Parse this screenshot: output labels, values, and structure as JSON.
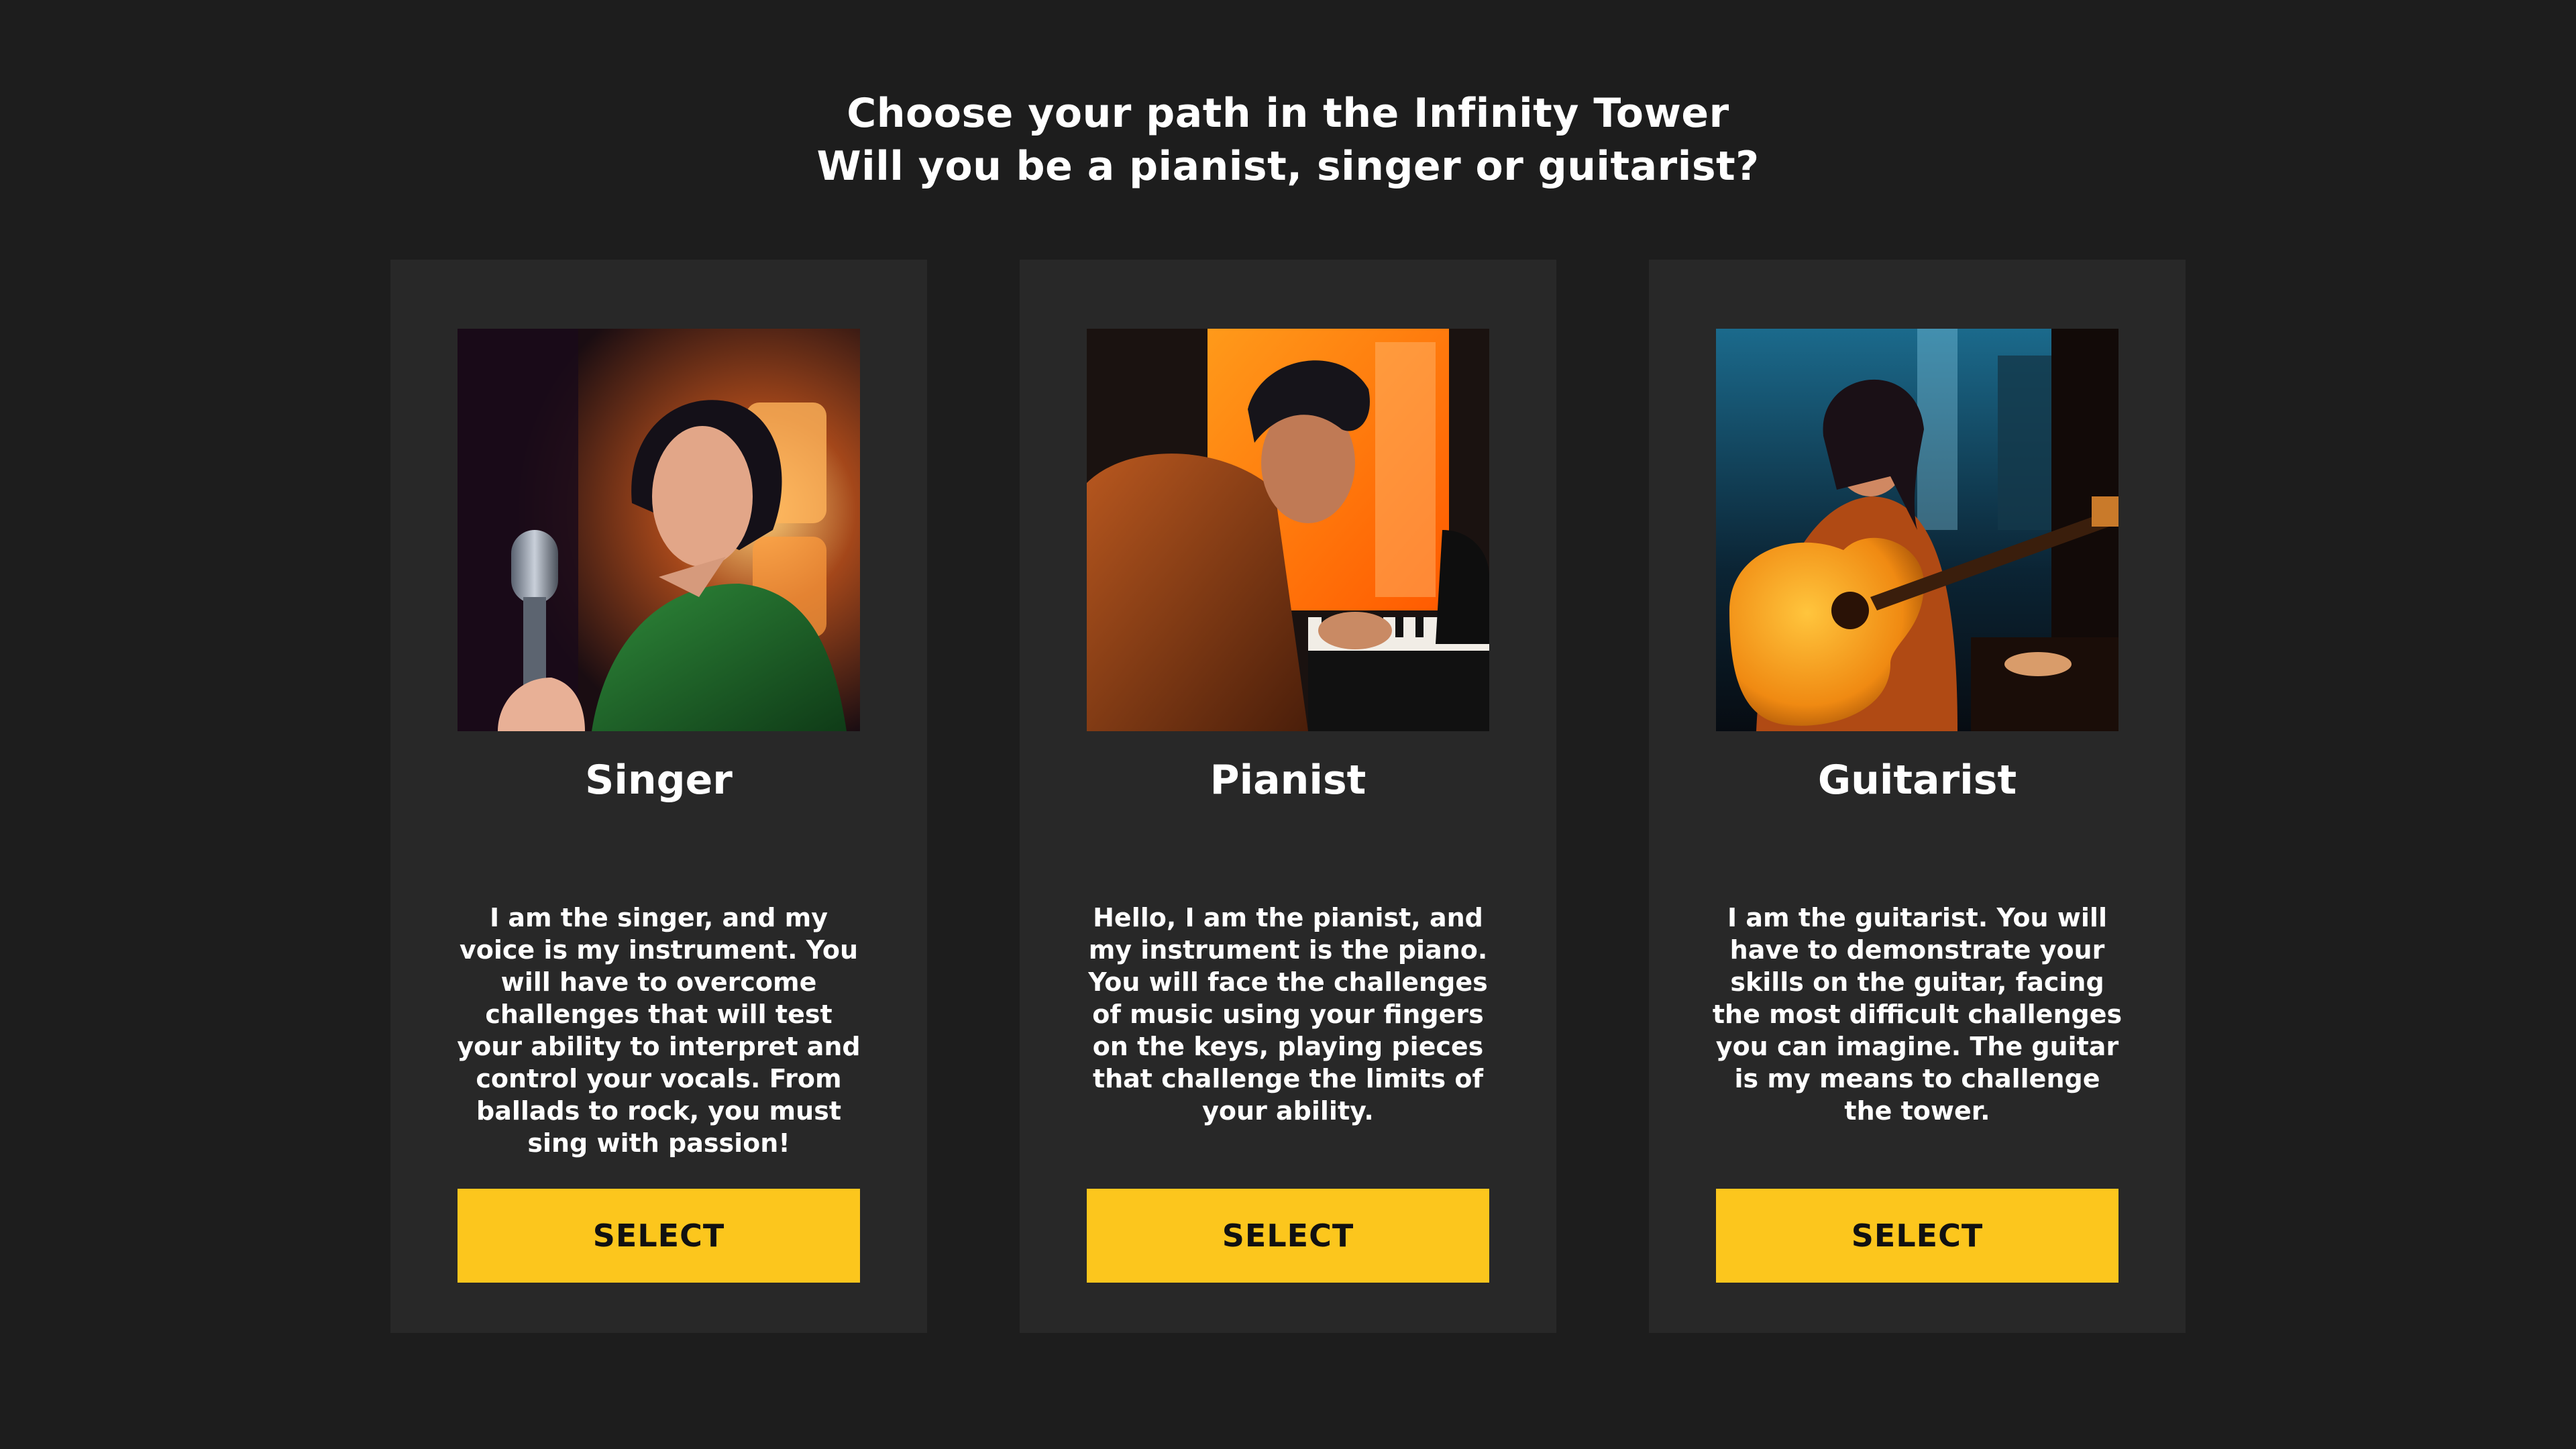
{
  "header": {
    "line1": "Choose your path in the Infinity Tower",
    "line2": "Will you be a pianist, singer or guitarist?"
  },
  "cards": [
    {
      "title": "Singer",
      "description": "I am the singer, and my voice is my instrument. You will have to overcome challenges that will test your ability to interpret and control your vocals. From ballads to rock, you must sing with passion!",
      "button_label": "SELECT"
    },
    {
      "title": "Pianist",
      "description": "Hello, I am the pianist, and my instrument is the piano. You will face the challenges of music using your fingers on the keys, playing pieces that challenge the limits of your ability.",
      "button_label": "SELECT"
    },
    {
      "title": "Guitarist",
      "description": "I am the guitarist. You will have to demonstrate your skills on the guitar, facing the most difficult challenges you can imagine. The guitar is my means to challenge the tower.",
      "button_label": "SELECT"
    }
  ],
  "colors": {
    "background": "#1d1d1d",
    "card": "#282828",
    "button": "#fcc61d",
    "button_text": "#111111",
    "text": "#ffffff"
  }
}
